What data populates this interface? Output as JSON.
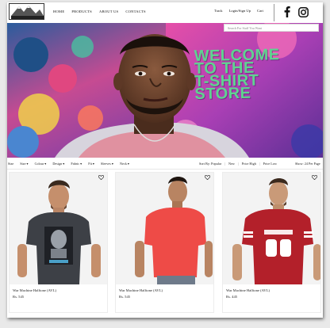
{
  "nav": {
    "links": [
      "HOME",
      "PRODUCTS",
      "ABOUT US",
      "CONTACTS"
    ]
  },
  "account": {
    "links": [
      "Track",
      "Login/Sign Up",
      "Cart"
    ]
  },
  "social": {
    "icons": [
      "facebook-icon",
      "instagram-icon"
    ]
  },
  "search": {
    "placeholder": "Search For Stuff You Want"
  },
  "hero": {
    "title_lines": [
      "WELCOME",
      "TO THE",
      "T-SHIRT",
      "STORE"
    ]
  },
  "filters": {
    "items": [
      "Size ▾",
      "Colour ▾",
      "Design ▾",
      "Fabric ▾",
      "Fit ▾",
      "Sleeves ▾",
      "Neck ▾"
    ],
    "left_fragment": "Size"
  },
  "sort": {
    "label": "Sort By: Popular",
    "options": [
      "New",
      "Price High",
      "Price Low"
    ],
    "per_page": "Show: 24 Per Page"
  },
  "products": [
    {
      "name": "War Machine Halftone (AVL)",
      "price": "Rs. 545",
      "shirt_color": "#3d4046"
    },
    {
      "name": "War Machine Halftone (AVL)",
      "price": "Rs. 545",
      "shirt_color": "#ee4b47"
    },
    {
      "name": "War Machine Halftone (AVL)",
      "price": "Rs. 445",
      "shirt_color": "#b3202a"
    }
  ],
  "colors": {
    "hero_text": "#5fd391",
    "frame_bg": "#ffffff",
    "page_bg": "#e9e9e9"
  }
}
